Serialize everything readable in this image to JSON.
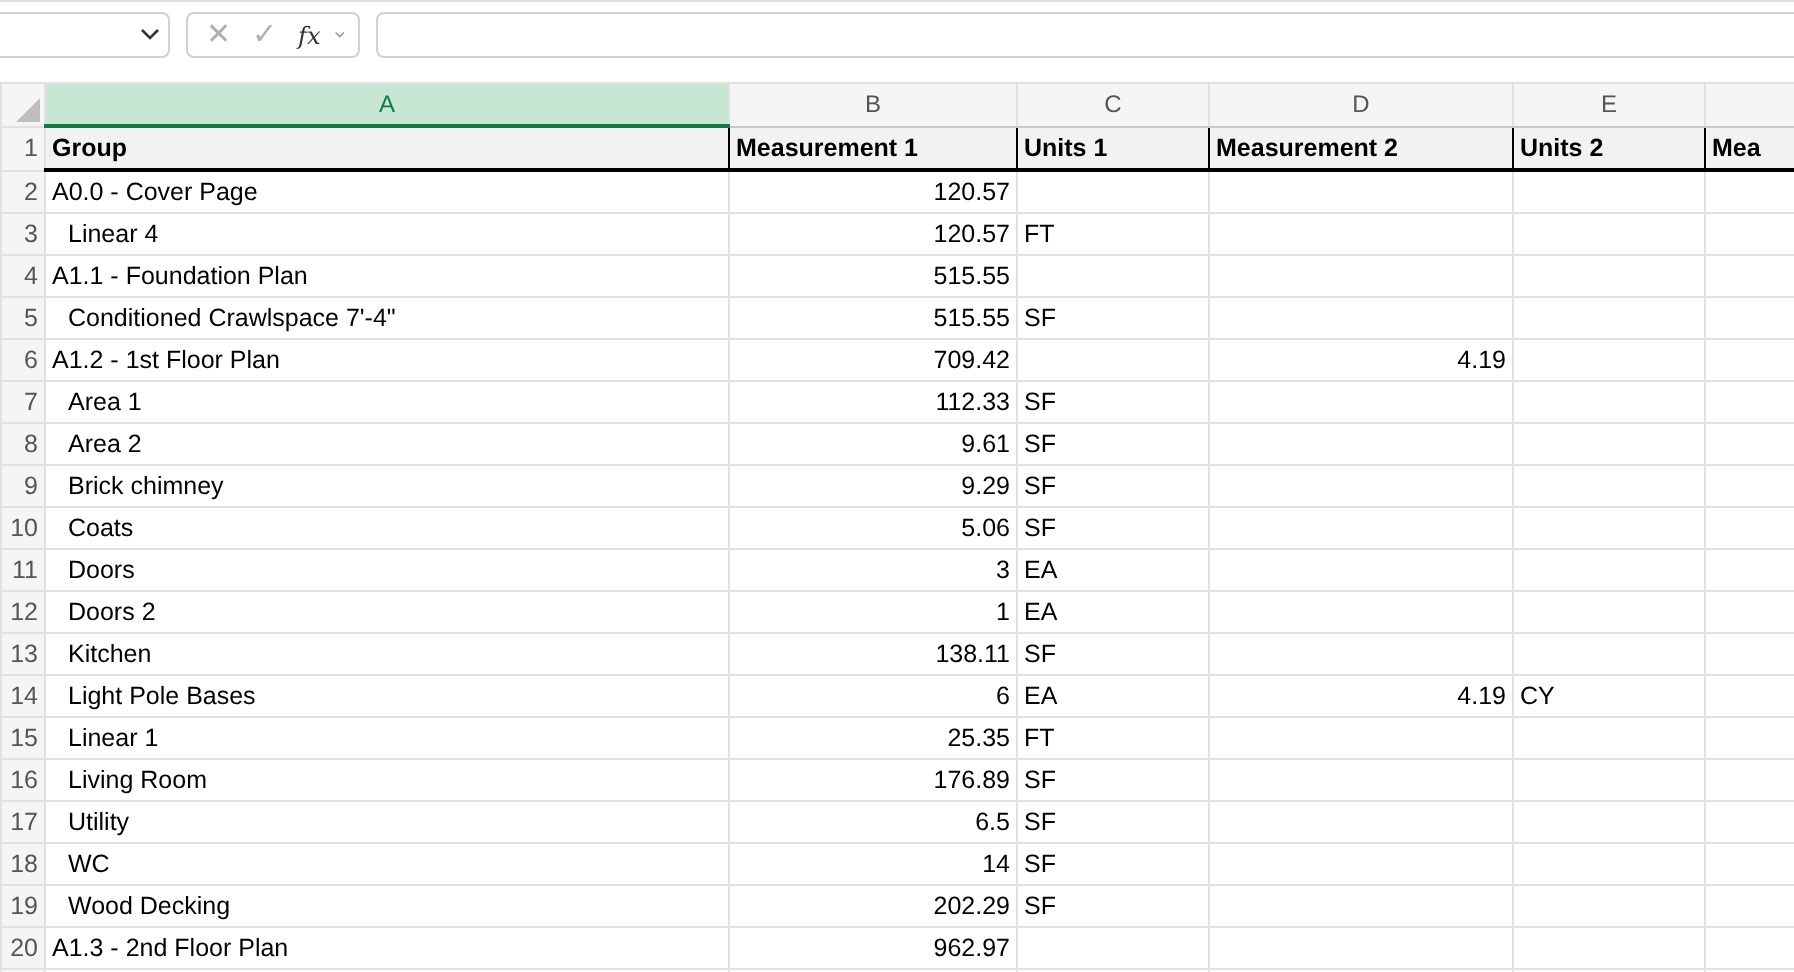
{
  "formula_bar": {
    "cancel_symbol": "✕",
    "enter_symbol": "✓",
    "function_symbol": "fx",
    "disabled": true
  },
  "columns": [
    {
      "label": "A",
      "selected": true
    },
    {
      "label": "B",
      "selected": false
    },
    {
      "label": "C",
      "selected": false
    },
    {
      "label": "D",
      "selected": false
    },
    {
      "label": "E",
      "selected": false
    }
  ],
  "header_row": {
    "row": "1",
    "cells": [
      "Group",
      "Measurement 1",
      "Units 1",
      "Measurement 2",
      "Units 2",
      "Mea"
    ]
  },
  "rows": [
    {
      "row": "2",
      "group": "A0.0 - Cover Page",
      "measurement_1": "120.57",
      "children": [
        {
          "row": "3",
          "group": "Linear 4",
          "measurement_1": "120.57",
          "units_1": "FT"
        }
      ]
    },
    {
      "row": "4",
      "group": "A1.1 - Foundation Plan",
      "measurement_1": "515.55",
      "children": [
        {
          "row": "5",
          "group": "Conditioned Crawlspace 7'-4\"",
          "measurement_1": "515.55",
          "units_1": "SF"
        }
      ]
    },
    {
      "row": "6",
      "group": "A1.2 - 1st Floor Plan",
      "measurement_1": "709.42",
      "measurement_2": "4.19",
      "children": [
        {
          "row": "7",
          "group": "Area 1",
          "measurement_1": "112.33",
          "units_1": "SF"
        },
        {
          "row": "8",
          "group": "Area 2",
          "measurement_1": "9.61",
          "units_1": "SF"
        },
        {
          "row": "9",
          "group": "Brick chimney",
          "measurement_1": "9.29",
          "units_1": "SF"
        },
        {
          "row": "10",
          "group": "Coats",
          "measurement_1": "5.06",
          "units_1": "SF"
        },
        {
          "row": "11",
          "group": "Doors",
          "measurement_1": "3",
          "units_1": "EA"
        },
        {
          "row": "12",
          "group": "Doors 2",
          "measurement_1": "1",
          "units_1": "EA"
        },
        {
          "row": "13",
          "group": "Kitchen",
          "measurement_1": "138.11",
          "units_1": "SF"
        },
        {
          "row": "14",
          "group": "Light Pole Bases",
          "measurement_1": "6",
          "units_1": "EA",
          "measurement_2": "4.19",
          "units_2": "CY"
        },
        {
          "row": "15",
          "group": "Linear 1",
          "measurement_1": "25.35",
          "units_1": "FT"
        },
        {
          "row": "16",
          "group": "Living Room",
          "measurement_1": "176.89",
          "units_1": "SF"
        },
        {
          "row": "17",
          "group": "Utility",
          "measurement_1": "6.5",
          "units_1": "SF"
        },
        {
          "row": "18",
          "group": "WC",
          "measurement_1": "14",
          "units_1": "SF"
        },
        {
          "row": "19",
          "group": "Wood Decking",
          "measurement_1": "202.29",
          "units_1": "SF"
        }
      ]
    },
    {
      "row": "20",
      "group": "A1.3 - 2nd Floor Plan",
      "measurement_1": "962.97"
    }
  ]
}
